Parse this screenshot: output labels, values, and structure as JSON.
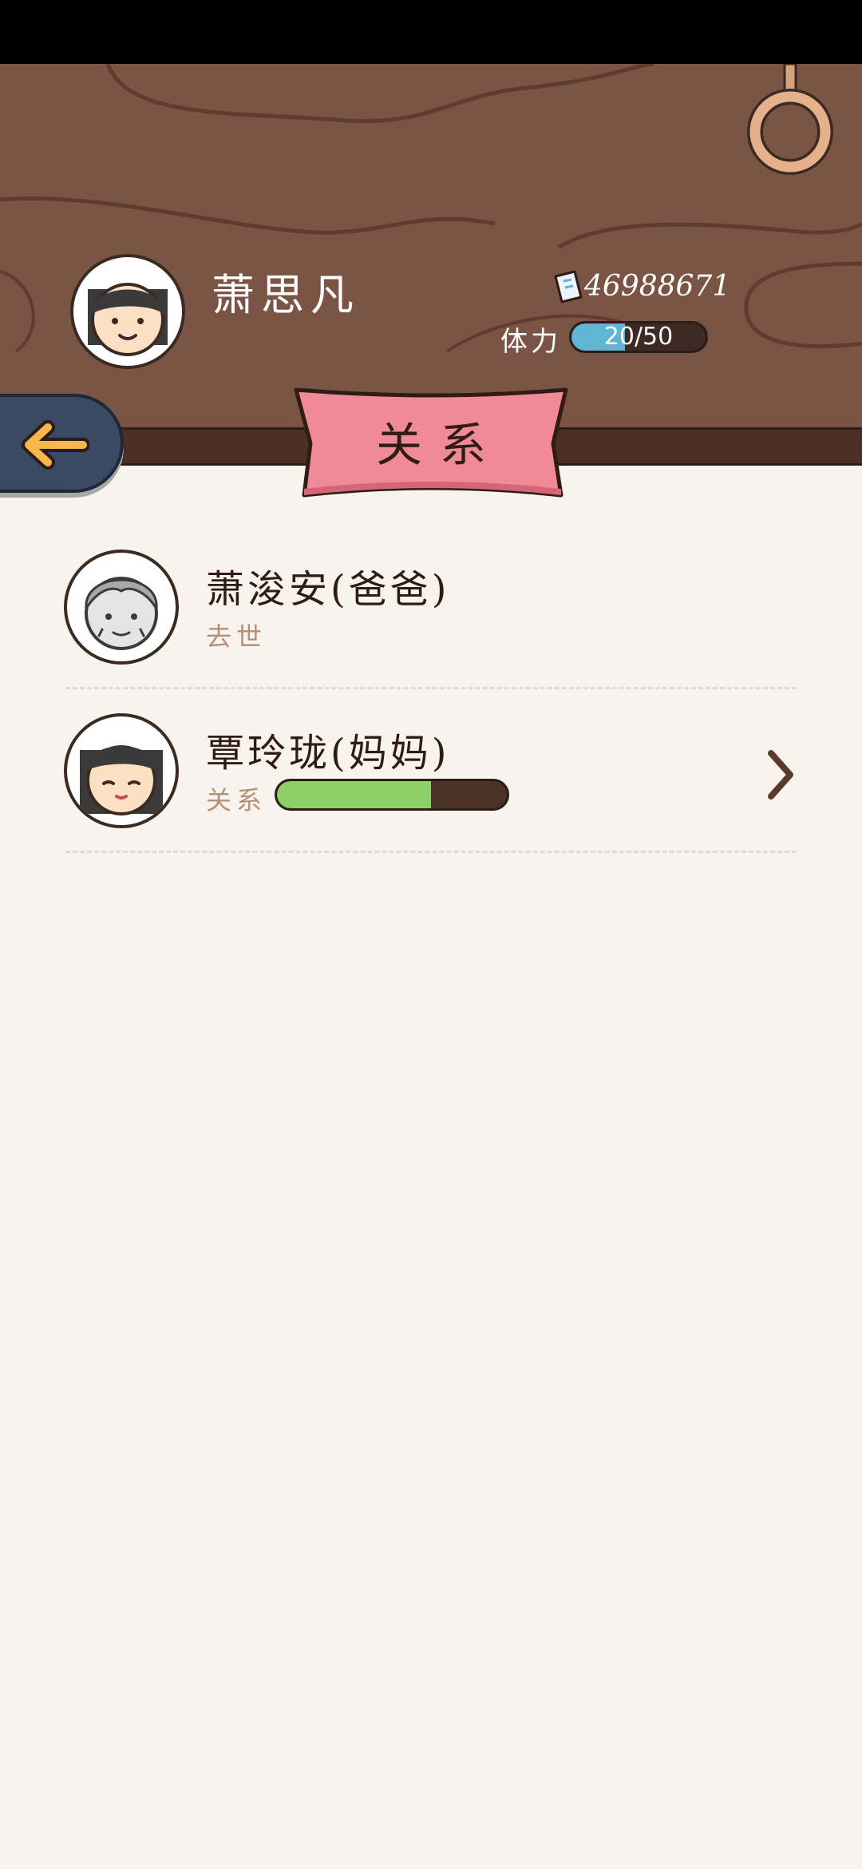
{
  "player": {
    "name": "萧思凡",
    "coins": "46988671",
    "stamina_label": "体力",
    "stamina_text": "20/50",
    "stamina_fraction": 0.4
  },
  "page": {
    "title": "关系"
  },
  "relations": [
    {
      "name": "萧浚安(爸爸)",
      "status": "去世",
      "avatar": "elderly-man-avatar"
    },
    {
      "name": "覃玲珑(妈妈)",
      "bar_label": "关系",
      "relationship_fraction": 0.67,
      "avatar": "woman-avatar"
    }
  ],
  "icons": {
    "back": "back-arrow-icon",
    "coin": "banknote-icon",
    "more": "chevron-right-icon",
    "ring": "ring-icon"
  },
  "colors": {
    "header_wood": "#7a5444",
    "banner": "#f08a96",
    "stamina": "#5fb5d4",
    "relationship": "#8dd068",
    "background": "#f8f3ec"
  }
}
